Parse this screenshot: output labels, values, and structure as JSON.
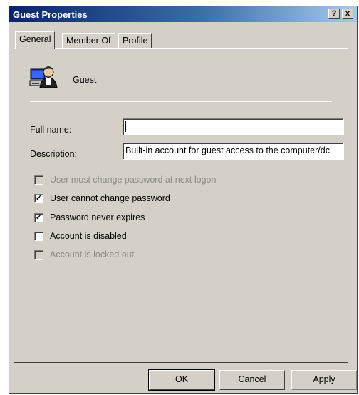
{
  "window": {
    "title": "Guest Properties",
    "help_glyph": "?",
    "close_glyph": "x"
  },
  "tabs": [
    {
      "label": "General",
      "active": true
    },
    {
      "label": "Member Of",
      "active": false
    },
    {
      "label": "Profile",
      "active": false
    }
  ],
  "account": {
    "icon": "user-account-computer-icon",
    "name": "Guest"
  },
  "form": {
    "full_name_label": "Full name:",
    "full_name_value": "",
    "description_label": "Description:",
    "description_value": "Built-in account for guest access to the computer/dc"
  },
  "options": [
    {
      "label": "User must change password at next logon",
      "checked": false,
      "enabled": false
    },
    {
      "label": "User cannot change password",
      "checked": true,
      "enabled": true
    },
    {
      "label": "Password never expires",
      "checked": true,
      "enabled": true
    },
    {
      "label": "Account is disabled",
      "checked": false,
      "enabled": true
    },
    {
      "label": "Account is locked out",
      "checked": false,
      "enabled": false
    }
  ],
  "buttons": {
    "ok": "OK",
    "cancel": "Cancel",
    "apply": "Apply"
  },
  "colors": {
    "titlebar_start": "#0a246a",
    "titlebar_end": "#a6caf0",
    "face": "#d4d0c8",
    "disabled_text": "#8c8a85"
  }
}
